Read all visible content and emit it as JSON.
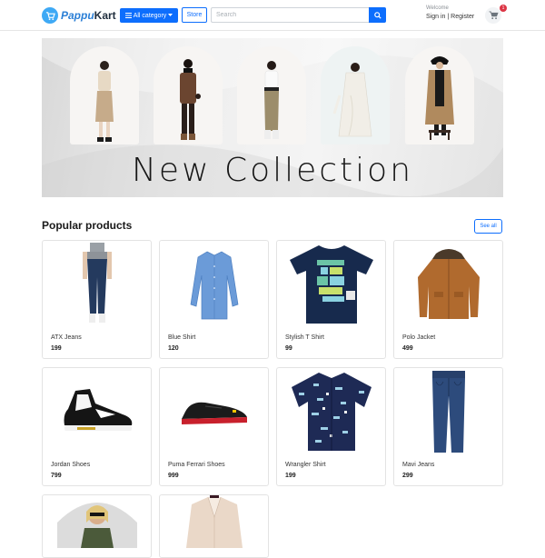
{
  "header": {
    "logo": {
      "prefix": "Pappu",
      "suffix": "Kart"
    },
    "category_label": "All category",
    "store_label": "Store",
    "search_placeholder": "Search",
    "welcome": "Welcome",
    "sign_in": "Sign in",
    "separator": "|",
    "register": "Register",
    "cart_count": "1"
  },
  "banner": {
    "title": "New Collection"
  },
  "popular": {
    "title": "Popular products",
    "see_all": "See all",
    "products": [
      {
        "name": "ATX Jeans",
        "price": "199",
        "icon": "jeans-model-image"
      },
      {
        "name": "Blue Shirt",
        "price": "120",
        "icon": "blue-shirt-image"
      },
      {
        "name": "Stylish T Shirt",
        "price": "99",
        "icon": "tshirt-image"
      },
      {
        "name": "Polo Jacket",
        "price": "499",
        "icon": "jacket-image"
      },
      {
        "name": "Jordan Shoes",
        "price": "799",
        "icon": "sneaker-image"
      },
      {
        "name": "Puma Ferrari Shoes",
        "price": "999",
        "icon": "shoe-image"
      },
      {
        "name": "Wrangler Shirt",
        "price": "199",
        "icon": "printed-shirt-image"
      },
      {
        "name": "Mavi Jeans",
        "price": "299",
        "icon": "jeans-image"
      },
      {
        "name": "",
        "price": "",
        "icon": "woman-portrait-image"
      },
      {
        "name": "",
        "price": "",
        "icon": "blazer-image"
      }
    ]
  },
  "colors": {
    "primary": "#0d6efd",
    "badge": "#dc3545",
    "logo": "#3ea9f5"
  }
}
